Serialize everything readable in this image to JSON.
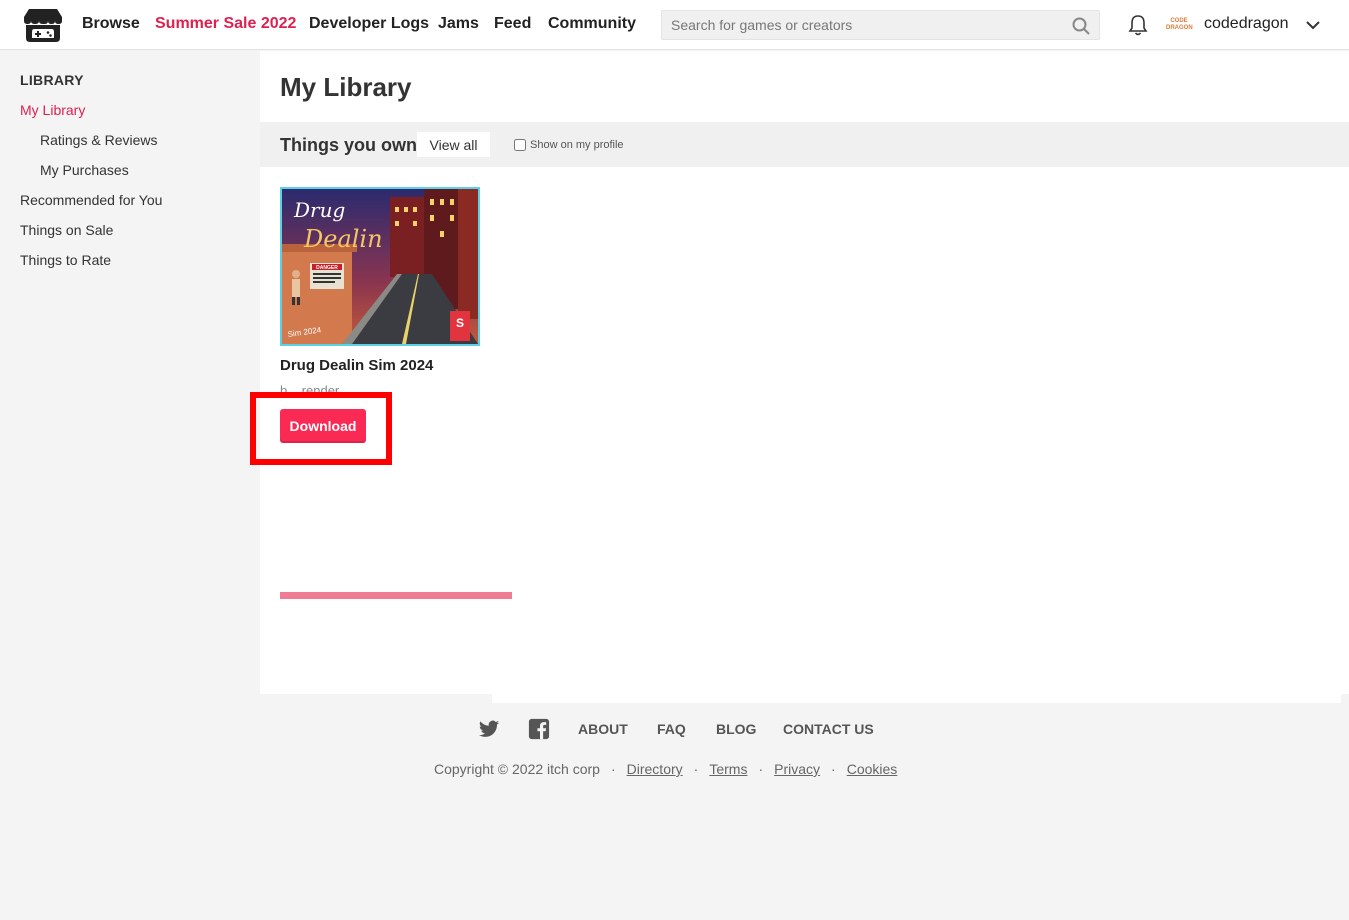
{
  "header": {
    "nav": [
      {
        "label": "Browse"
      },
      {
        "label": "Summer Sale 2022"
      },
      {
        "label": "Developer Logs"
      },
      {
        "label": "Jams"
      },
      {
        "label": "Feed"
      },
      {
        "label": "Community"
      }
    ],
    "search_placeholder": "Search for games or creators",
    "avatar_text": "CODE DRAGON",
    "username": "codedragon"
  },
  "sidebar": {
    "heading": "LIBRARY",
    "items": [
      {
        "label": "My Library"
      },
      {
        "label": "Ratings & Reviews"
      },
      {
        "label": "My Purchases"
      },
      {
        "label": "Recommended for You"
      },
      {
        "label": "Things on Sale"
      },
      {
        "label": "Things to Rate"
      }
    ]
  },
  "main": {
    "title": "My Library",
    "section_title": "Things you own",
    "view_all": "View all",
    "show_on_profile": "Show on my profile",
    "show_on_profile_checked": false,
    "game": {
      "title": "Drug Dealin Sim 2024",
      "author": "b... render",
      "download": "Download",
      "thumb_title_line1": "Drug",
      "thumb_title_line2": "Dealin",
      "thumb_subtitle": "Sim 2024",
      "thumb_badge": "S",
      "thumb_sign": "DANGER"
    },
    "download_progress": 1.0
  },
  "footer": {
    "links": [
      {
        "label": "ABOUT"
      },
      {
        "label": "FAQ"
      },
      {
        "label": "BLOG"
      },
      {
        "label": "CONTACT US"
      }
    ],
    "copyright": "Copyright © 2022 itch corp",
    "legal": [
      {
        "label": "Directory"
      },
      {
        "label": "Terms"
      },
      {
        "label": "Privacy"
      },
      {
        "label": "Cookies"
      }
    ]
  },
  "colors": {
    "accent": "#de2151",
    "button": "#fa2a55",
    "thumb_border": "#5bd0e6",
    "highlight": "#ff0000"
  }
}
